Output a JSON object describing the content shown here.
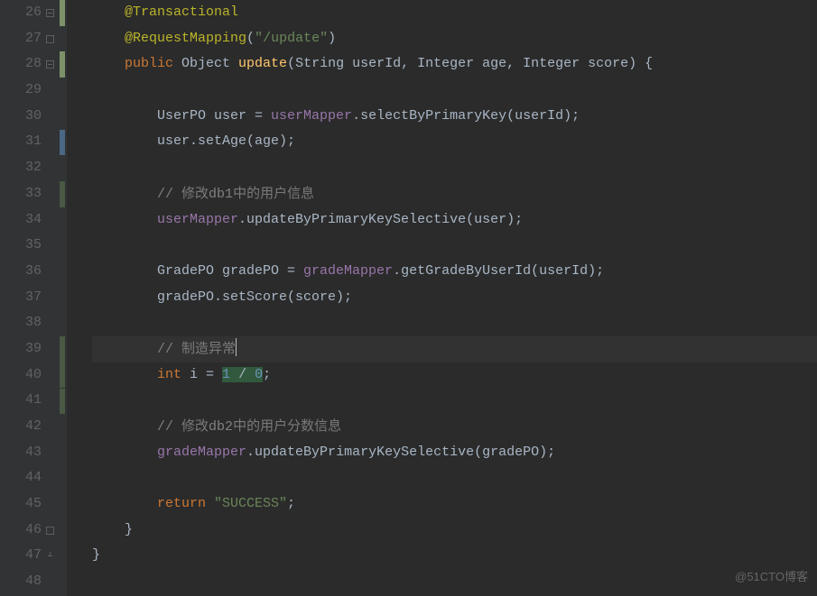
{
  "watermark": "@51CTO博客",
  "lines": [
    {
      "num": "26",
      "marker": "light",
      "fold": "minus",
      "tokens": [
        {
          "t": "    ",
          "c": "txt"
        },
        {
          "t": "@Transactional",
          "c": "ann"
        }
      ]
    },
    {
      "num": "27",
      "fold": "box",
      "tokens": [
        {
          "t": "    ",
          "c": "txt"
        },
        {
          "t": "@RequestMapping",
          "c": "ann"
        },
        {
          "t": "(",
          "c": "txt"
        },
        {
          "t": "\"/update\"",
          "c": "str"
        },
        {
          "t": ")",
          "c": "txt"
        }
      ]
    },
    {
      "num": "28",
      "marker": "light",
      "fold": "minus",
      "tokens": [
        {
          "t": "    ",
          "c": "txt"
        },
        {
          "t": "public",
          "c": "kw"
        },
        {
          "t": " Object ",
          "c": "txt"
        },
        {
          "t": "update",
          "c": "mtd"
        },
        {
          "t": "(String userId, Integer age, Integer score) {",
          "c": "txt"
        }
      ]
    },
    {
      "num": "29",
      "tokens": []
    },
    {
      "num": "30",
      "tokens": [
        {
          "t": "        UserPO user = ",
          "c": "txt"
        },
        {
          "t": "userMapper",
          "c": "fld"
        },
        {
          "t": ".selectByPrimaryKey(userId);",
          "c": "txt"
        }
      ]
    },
    {
      "num": "31",
      "marker": "blue",
      "tokens": [
        {
          "t": "        user.setAge(age);",
          "c": "txt"
        }
      ]
    },
    {
      "num": "32",
      "tokens": []
    },
    {
      "num": "33",
      "marker": "green",
      "tokens": [
        {
          "t": "        ",
          "c": "txt"
        },
        {
          "t": "// ",
          "c": "cmt"
        },
        {
          "t": "修改",
          "c": "cmt-cn"
        },
        {
          "t": "db1",
          "c": "cmt"
        },
        {
          "t": "中的用户信息",
          "c": "cmt-cn"
        }
      ]
    },
    {
      "num": "34",
      "tokens": [
        {
          "t": "        ",
          "c": "txt"
        },
        {
          "t": "userMapper",
          "c": "fld"
        },
        {
          "t": ".updateByPrimaryKeySelective(user);",
          "c": "txt"
        }
      ]
    },
    {
      "num": "35",
      "tokens": []
    },
    {
      "num": "36",
      "tokens": [
        {
          "t": "        GradePO gradePO = ",
          "c": "txt"
        },
        {
          "t": "gradeMapper",
          "c": "fld"
        },
        {
          "t": ".getGradeByUserId(userId);",
          "c": "txt"
        }
      ]
    },
    {
      "num": "37",
      "tokens": [
        {
          "t": "        gradePO.setScore(score);",
          "c": "txt"
        }
      ]
    },
    {
      "num": "38",
      "tokens": []
    },
    {
      "num": "39",
      "marker": "green",
      "current": true,
      "cursor": true,
      "tokens": [
        {
          "t": "        ",
          "c": "txt"
        },
        {
          "t": "// ",
          "c": "cmt"
        },
        {
          "t": "制造异常",
          "c": "cmt-cn"
        }
      ]
    },
    {
      "num": "40",
      "marker": "green",
      "tokens": [
        {
          "t": "        ",
          "c": "txt"
        },
        {
          "t": "int",
          "c": "kw"
        },
        {
          "t": " i = ",
          "c": "txt"
        },
        {
          "t": "1",
          "c": "num hl"
        },
        {
          "t": " / ",
          "c": "txt hl"
        },
        {
          "t": "0",
          "c": "num hl"
        },
        {
          "t": ";",
          "c": "txt"
        }
      ]
    },
    {
      "num": "41",
      "marker": "green",
      "tokens": []
    },
    {
      "num": "42",
      "tokens": [
        {
          "t": "        ",
          "c": "txt"
        },
        {
          "t": "// ",
          "c": "cmt"
        },
        {
          "t": "修改",
          "c": "cmt-cn"
        },
        {
          "t": "db2",
          "c": "cmt"
        },
        {
          "t": "中的用户分数信息",
          "c": "cmt-cn"
        }
      ]
    },
    {
      "num": "43",
      "tokens": [
        {
          "t": "        ",
          "c": "txt"
        },
        {
          "t": "gradeMapper",
          "c": "fld"
        },
        {
          "t": ".updateByPrimaryKeySelective(gradePO);",
          "c": "txt"
        }
      ]
    },
    {
      "num": "44",
      "play": true,
      "tokens": []
    },
    {
      "num": "45",
      "tokens": [
        {
          "t": "        ",
          "c": "txt"
        },
        {
          "t": "return ",
          "c": "kw"
        },
        {
          "t": "\"SUCCESS\"",
          "c": "str"
        },
        {
          "t": ";",
          "c": "txt"
        }
      ]
    },
    {
      "num": "46",
      "fold": "box",
      "tokens": [
        {
          "t": "    }",
          "c": "txt"
        }
      ]
    },
    {
      "num": "47",
      "fold": "minus-end",
      "tokens": [
        {
          "t": "}",
          "c": "txt"
        }
      ]
    },
    {
      "num": "48",
      "tokens": []
    }
  ]
}
